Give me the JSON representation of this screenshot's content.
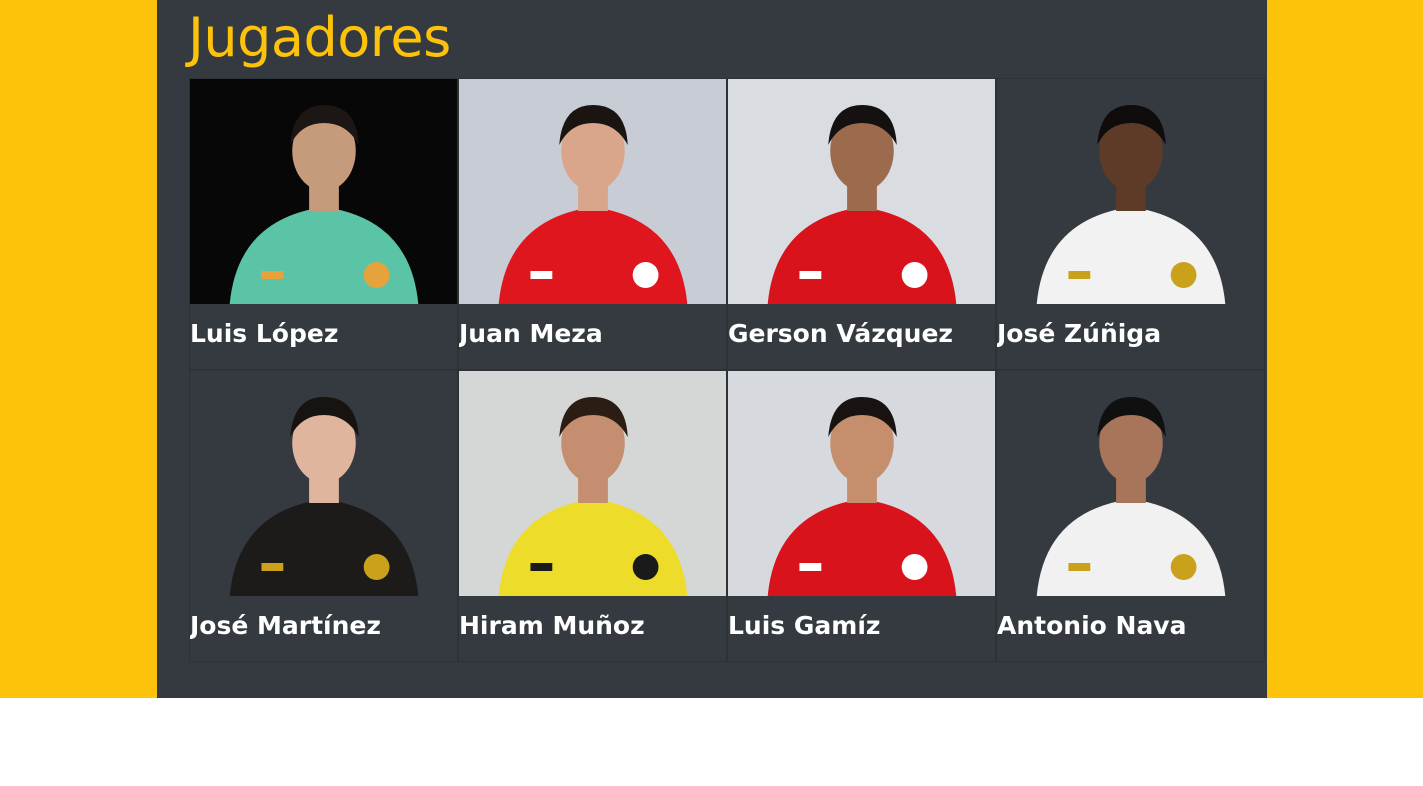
{
  "section": {
    "title": "Jugadores"
  },
  "colors": {
    "accent": "#fdc20a",
    "panel": "#343a40"
  },
  "players": [
    {
      "name": "Luis López",
      "photo": {
        "bg": "#070707",
        "jersey": "#5cc4a6",
        "skin": "#c69b7c",
        "hair": "#1c1714",
        "accent": "#e6a23c"
      }
    },
    {
      "name": "Juan Meza",
      "photo": {
        "bg": "#c8ccd4",
        "jersey": "#e0161f",
        "skin": "#d9a58b",
        "hair": "#1b1512",
        "accent": "#ffffff"
      }
    },
    {
      "name": "Gerson Vázquez",
      "photo": {
        "bg": "#d9dde2",
        "jersey": "#d8131c",
        "skin": "#9c6a4c",
        "hair": "#141110",
        "accent": "#ffffff"
      }
    },
    {
      "name": "José Zúñiga",
      "photo": {
        "bg": "#343a40",
        "jersey": "#f2f2f2",
        "skin": "#5e3b27",
        "hair": "#0f0c0b",
        "accent": "#caa11b"
      }
    },
    {
      "name": "José Martínez",
      "photo": {
        "bg": "#343a40",
        "jersey": "#1c1b19",
        "skin": "#e0b59d",
        "hair": "#171311",
        "accent": "#caa11b"
      }
    },
    {
      "name": "Hiram Muñoz",
      "photo": {
        "bg": "#d4d7d6",
        "jersey": "#eedc2b",
        "skin": "#c58e70",
        "hair": "#2b1d14",
        "accent": "#1a1a1a"
      }
    },
    {
      "name": "Luis Gamíz",
      "photo": {
        "bg": "#d6dade",
        "jersey": "#d8131c",
        "skin": "#c58e6d",
        "hair": "#181310",
        "accent": "#ffffff"
      }
    },
    {
      "name": "Antonio Nava",
      "photo": {
        "bg": "#343a40",
        "jersey": "#f1f1f1",
        "skin": "#a7765a",
        "hair": "#111010",
        "accent": "#caa11b"
      }
    }
  ]
}
